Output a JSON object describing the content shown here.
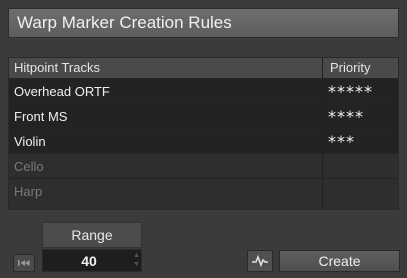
{
  "window": {
    "title": "Warp Marker Creation Rules"
  },
  "table": {
    "columns": {
      "name": "Hitpoint Tracks",
      "priority": "Priority"
    },
    "rows": [
      {
        "name": "Overhead ORTF",
        "priority": "*****",
        "enabled": true
      },
      {
        "name": "Front MS",
        "priority": "****",
        "enabled": true
      },
      {
        "name": "Violin",
        "priority": "***",
        "enabled": true
      },
      {
        "name": "Cello",
        "priority": "",
        "enabled": false
      },
      {
        "name": "Harp",
        "priority": "",
        "enabled": false
      }
    ]
  },
  "range": {
    "label": "Range",
    "value": "40"
  },
  "buttons": {
    "create": "Create",
    "rewind_icon": "skip-to-start-icon",
    "wave_icon": "waveform-icon"
  }
}
